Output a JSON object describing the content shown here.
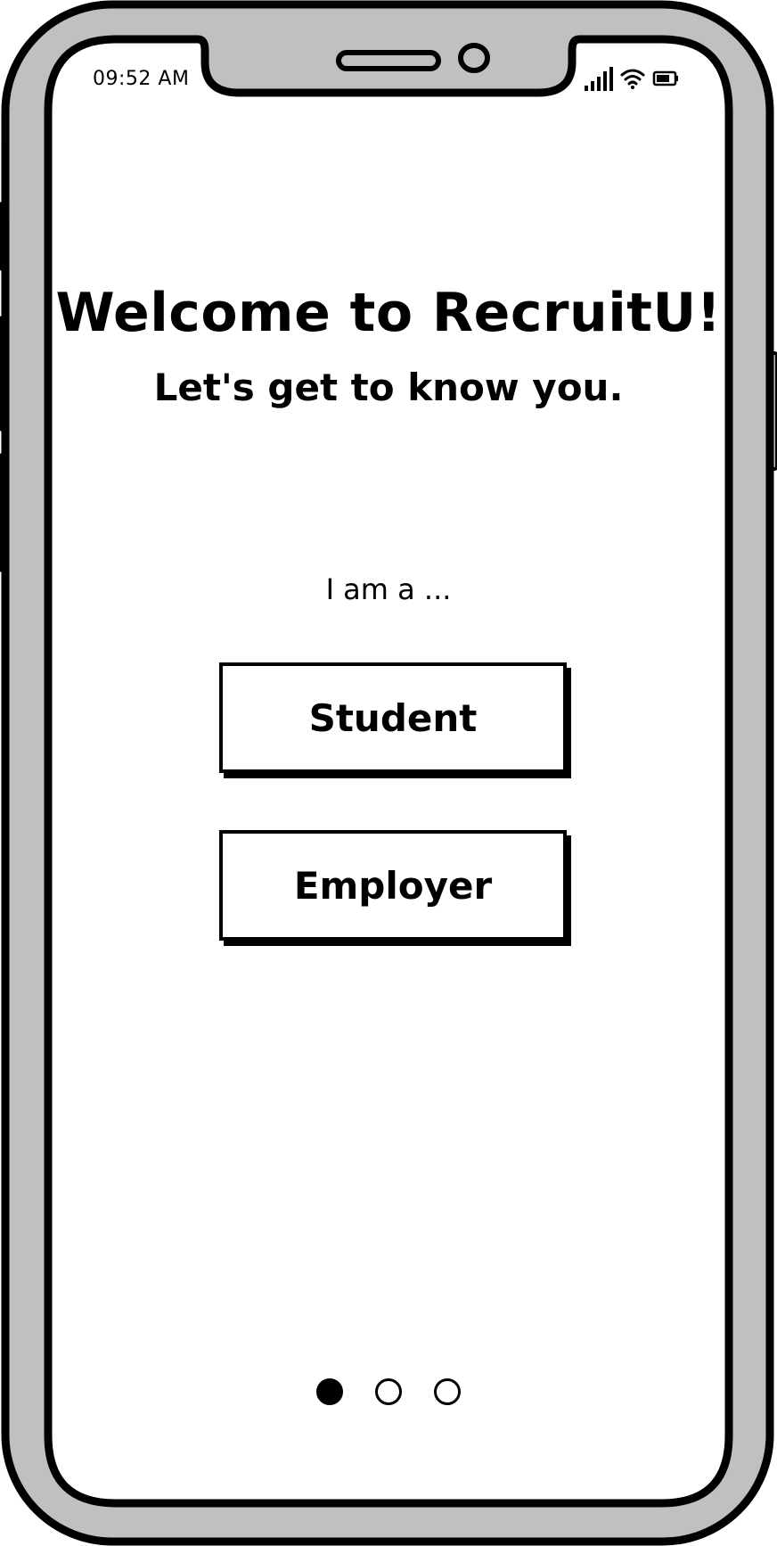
{
  "status_bar": {
    "time": "09:52 AM",
    "icons": [
      "cellular-signal-icon",
      "wifi-icon",
      "battery-icon"
    ]
  },
  "welcome": {
    "title": "Welcome to RecruitU!",
    "subtitle": "Let's get to know you."
  },
  "role_selection": {
    "prompt": "I am a ...",
    "options": [
      {
        "label": "Student"
      },
      {
        "label": "Employer"
      }
    ]
  },
  "pager": {
    "total_pages": 3,
    "current_page": 1
  },
  "colors": {
    "frame": "#c0c0c0",
    "outline": "#000000",
    "screen": "#ffffff"
  }
}
